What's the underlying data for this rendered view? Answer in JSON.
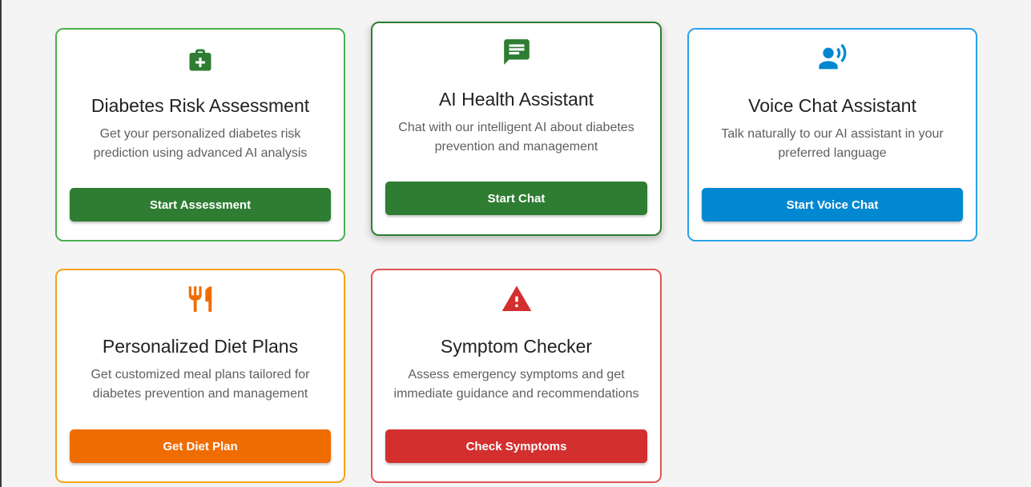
{
  "colors": {
    "green": "#2e7d32",
    "green_border": "#4caf50",
    "blue": "#0288d1",
    "blue_border": "#29a3e8",
    "orange": "#ef6c00",
    "orange_border": "#f5a21b",
    "red": "#d32f2f",
    "red_border": "#e05555",
    "background": "#f4f4f4"
  },
  "cards": [
    {
      "icon": "medical-bag-icon",
      "title": "Diabetes Risk Assessment",
      "description": "Get your personalized diabetes risk prediction using advanced AI analysis",
      "button_label": "Start Assessment"
    },
    {
      "icon": "chat-icon",
      "title": "AI Health Assistant",
      "description": "Chat with our intelligent AI about diabetes prevention and management",
      "button_label": "Start Chat"
    },
    {
      "icon": "voice-chat-icon",
      "title": "Voice Chat Assistant",
      "description": "Talk naturally to our AI assistant in your preferred language",
      "button_label": "Start Voice Chat"
    },
    {
      "icon": "restaurant-icon",
      "title": "Personalized Diet Plans",
      "description": "Get customized meal plans tailored for diabetes prevention and management",
      "button_label": "Get Diet Plan"
    },
    {
      "icon": "warning-icon",
      "title": "Symptom Checker",
      "description": "Assess emergency symptoms and get immediate guidance and recommendations",
      "button_label": "Check Symptoms"
    }
  ]
}
